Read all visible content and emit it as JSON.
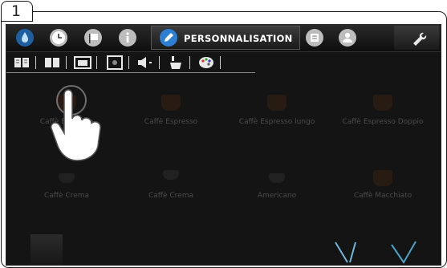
{
  "step_number": "1",
  "header": {
    "active_tab_label": "PERSONNALISATION",
    "tabs": [
      {
        "icon": "water-drop-icon",
        "color": "#2d7fd3"
      },
      {
        "icon": "clock-icon",
        "color": "#9a9a9a"
      },
      {
        "icon": "flag-icon",
        "color": "#9a9a9a"
      },
      {
        "icon": "info-icon",
        "color": "#9a9a9a"
      },
      {
        "icon": "pen-icon",
        "color": "#2d7fd3"
      },
      {
        "icon": "receipt-icon",
        "color": "#9a9a9a"
      },
      {
        "icon": "user-icon",
        "color": "#9a9a9a"
      },
      {
        "icon": "wrench-icon",
        "color": "#9a9a9a"
      }
    ]
  },
  "subbar": {
    "items": [
      "book-icon",
      "touch-book-icon",
      "screen-image-icon",
      "photo-frame-icon",
      "speaker-icon",
      "cup-pour-icon",
      "palette-icon"
    ]
  },
  "products": [
    {
      "label": "Caffè Espresso"
    },
    {
      "label": "Caffè Espresso"
    },
    {
      "label": "Caffè Espresso lungo"
    },
    {
      "label": "Caffè Espresso Doppio"
    },
    {
      "label": "Caffè Crema"
    },
    {
      "label": "Caffè Crema"
    },
    {
      "label": "Americano"
    },
    {
      "label": "Caffè Macchiato"
    }
  ],
  "colors": {
    "accent": "#2d7fd3",
    "background": "#141414"
  }
}
